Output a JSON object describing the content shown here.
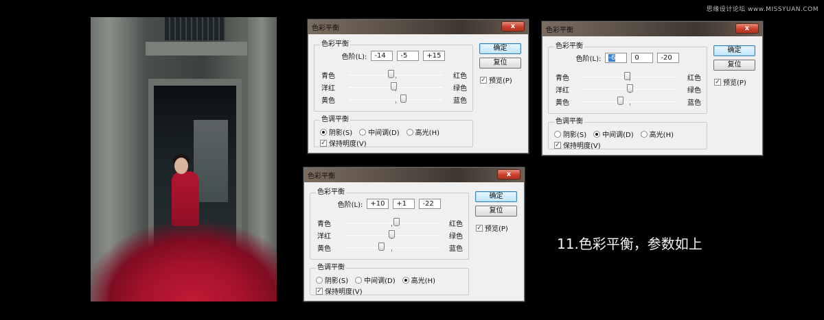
{
  "watermark": "思缘设计论坛 www.MISSYUAN.COM",
  "caption": "11.色彩平衡，参数如上",
  "colors": {
    "background": "#000000",
    "dialog_bg": "#f0f0f0",
    "title_bar": "#5e5349",
    "close_button": "#c8402a",
    "ok_button": "#bee6fd"
  },
  "dialogs": [
    {
      "title": "色彩平衡",
      "close_label": "x",
      "group_balance": "色彩平衡",
      "levels_label": "色阶(L):",
      "levels": [
        "-14",
        "-5",
        "+15"
      ],
      "sliders": [
        {
          "left": "青色",
          "right": "红色",
          "pos": 0.45
        },
        {
          "left": "洋红",
          "right": "绿色",
          "pos": 0.48
        },
        {
          "left": "黄色",
          "right": "蓝色",
          "pos": 0.58
        }
      ],
      "group_tone": "色调平衡",
      "radios": [
        {
          "label": "阴影(S)",
          "checked": true
        },
        {
          "label": "中间调(D)",
          "checked": false
        },
        {
          "label": "高光(H)",
          "checked": false
        }
      ],
      "preserve": "保持明度(V)",
      "preserve_checked": true,
      "ok": "确定",
      "reset": "复位",
      "preview": "预览(P)",
      "preview_checked": true
    },
    {
      "title": "色彩平衡",
      "close_label": "x",
      "group_balance": "色彩平衡",
      "levels_label": "色阶(L):",
      "levels": [
        "-6",
        "0",
        "-20"
      ],
      "sliders": [
        {
          "left": "青色",
          "right": "红色",
          "pos": 0.47
        },
        {
          "left": "洋红",
          "right": "绿色",
          "pos": 0.5
        },
        {
          "left": "黄色",
          "right": "蓝色",
          "pos": 0.4
        }
      ],
      "group_tone": "色调平衡",
      "radios": [
        {
          "label": "阴影(S)",
          "checked": false
        },
        {
          "label": "中间调(D)",
          "checked": true
        },
        {
          "label": "高光(H)",
          "checked": false
        }
      ],
      "preserve": "保持明度(V)",
      "preserve_checked": true,
      "ok": "确定",
      "reset": "复位",
      "preview": "预览(P)",
      "preview_checked": true
    },
    {
      "title": "色彩平衡",
      "close_label": "x",
      "group_balance": "色彩平衡",
      "levels_label": "色阶(L):",
      "levels": [
        "+10",
        "+1",
        "-22"
      ],
      "sliders": [
        {
          "left": "青色",
          "right": "红色",
          "pos": 0.55
        },
        {
          "left": "洋红",
          "right": "绿色",
          "pos": 0.5
        },
        {
          "left": "黄色",
          "right": "蓝色",
          "pos": 0.39
        }
      ],
      "group_tone": "色调平衡",
      "radios": [
        {
          "label": "阴影(S)",
          "checked": false
        },
        {
          "label": "中间调(D)",
          "checked": false
        },
        {
          "label": "高光(H)",
          "checked": true
        }
      ],
      "preserve": "保持明度(V)",
      "preserve_checked": true,
      "ok": "确定",
      "reset": "复位",
      "preview": "预览(P)",
      "preview_checked": true
    }
  ]
}
